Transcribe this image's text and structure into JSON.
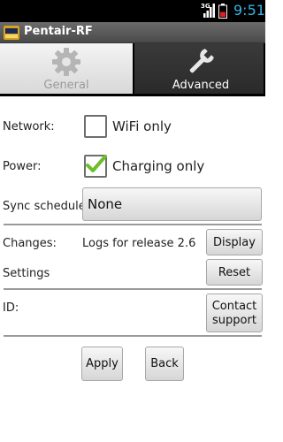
{
  "status_bar": {
    "network": "3G",
    "time": "9:51"
  },
  "app": {
    "title": "Pentair-RF"
  },
  "tabs": [
    {
      "label": "General",
      "icon": "gear-icon",
      "selected": false
    },
    {
      "label": "Advanced",
      "icon": "wrench-icon",
      "selected": true
    }
  ],
  "network": {
    "label": "Network:",
    "option_label": "WiFi only",
    "checked": false
  },
  "power": {
    "label": "Power:",
    "option_label": "Charging only",
    "checked": true
  },
  "sync": {
    "label": "Sync schedule:",
    "value": "None"
  },
  "changes": {
    "label": "Changes:",
    "value": "Logs for release 2.6",
    "button": "Display"
  },
  "settings": {
    "label": "Settings",
    "button": "Reset"
  },
  "id": {
    "label": "ID:",
    "button_line1": "Contact",
    "button_line2": "support"
  },
  "actions": {
    "apply": "Apply",
    "back": "Back"
  },
  "colors": {
    "accent": "#33b5e5",
    "check": "#6cbe2a",
    "battery": "#e02020"
  }
}
